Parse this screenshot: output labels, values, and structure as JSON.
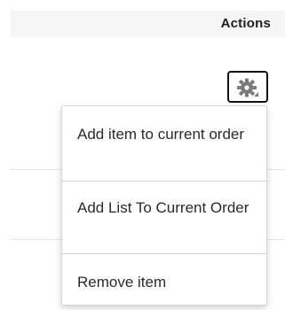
{
  "table": {
    "actions_header": "Actions"
  },
  "row": {
    "action_button_icon": "gear-icon"
  },
  "action_menu": {
    "items": [
      {
        "label": "Add item to current order"
      },
      {
        "label": "Add List To Current Order"
      },
      {
        "label": "Remove item"
      }
    ]
  },
  "colors": {
    "header_bg": "#f5f5f5",
    "text": "#2a2a2a",
    "icon_gray": "#7a7a7a",
    "button_border": "#111111"
  }
}
